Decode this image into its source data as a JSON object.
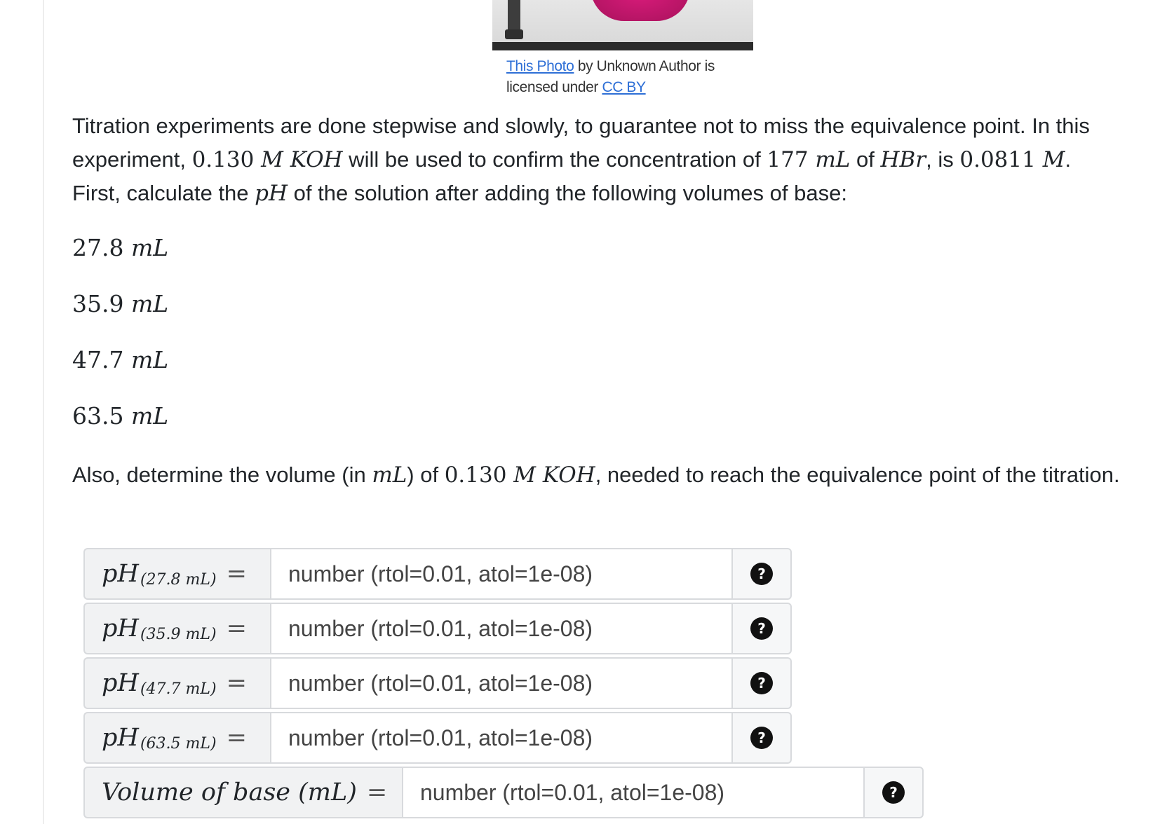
{
  "caption": {
    "link1": "This Photo",
    "text1": " by Unknown Author is",
    "text2": "licensed under ",
    "link2": "CC BY"
  },
  "problem": {
    "p1_a": "Titration experiments are done stepwise and slowly, to guarantee not to miss the equivalence point. In this experiment, ",
    "p1_conc": "0.130",
    "p1_unit": " M KOH",
    "p1_b": " will be used to confirm the concentration of ",
    "p1_vol": "177",
    "p1_volunit": " mL",
    "p1_c": " of ",
    "p1_acid": "HBr",
    "p1_d": ", is ",
    "p1_acidconc": "0.0811",
    "p1_acidunit": " M",
    "p1_e": ".",
    "p2_a": "First, calculate the ",
    "p2_ph": "pH",
    "p2_b": " of the solution after adding the following volumes of base:",
    "volumes": [
      {
        "value": "27.8",
        "unit": " mL"
      },
      {
        "value": "35.9",
        "unit": " mL"
      },
      {
        "value": "47.7",
        "unit": " mL"
      },
      {
        "value": "63.5",
        "unit": " mL"
      }
    ],
    "p3_a": "Also, determine the volume (in ",
    "p3_ml": "mL",
    "p3_b": ") of ",
    "p3_conc": "0.130",
    "p3_unit": " M KOH",
    "p3_c": ", needed to reach the equivalence point of the titration."
  },
  "answers": [
    {
      "label": "pH",
      "sub": "(27.8 mL)",
      "eq": "=",
      "placeholder": "number (rtol=0.01, atol=1e-08)",
      "help": "?"
    },
    {
      "label": "pH",
      "sub": "(35.9 mL)",
      "eq": "=",
      "placeholder": "number (rtol=0.01, atol=1e-08)",
      "help": "?"
    },
    {
      "label": "pH",
      "sub": "(47.7 mL)",
      "eq": "=",
      "placeholder": "number (rtol=0.01, atol=1e-08)",
      "help": "?"
    },
    {
      "label": "pH",
      "sub": "(63.5 mL)",
      "eq": "=",
      "placeholder": "number (rtol=0.01, atol=1e-08)",
      "help": "?"
    },
    {
      "label": "Volume of base (mL)",
      "sub": "",
      "eq": "=",
      "placeholder": "number (rtol=0.01, atol=1e-08)",
      "help": "?"
    }
  ]
}
